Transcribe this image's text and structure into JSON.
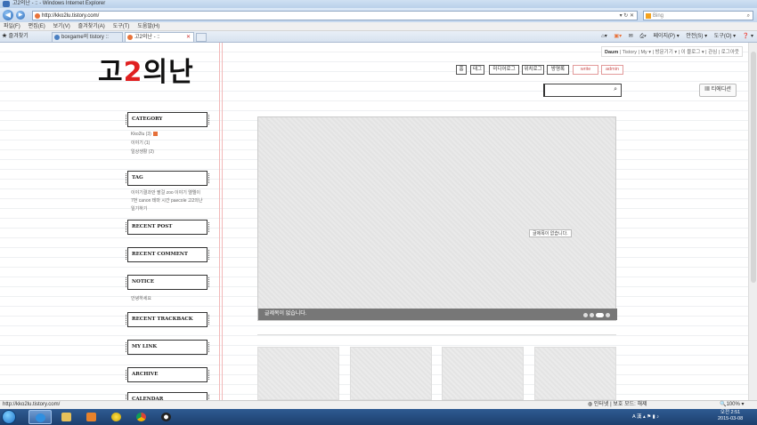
{
  "window": {
    "title": "고2의난 - :: - Windows Internet Explorer",
    "address": "http://kko2lu.tistory.com/",
    "search_placeholder": "Bing",
    "address_tools": "▾  ↻  ✕"
  },
  "menu": [
    "파일(F)",
    "편집(E)",
    "보기(V)",
    "즐겨찾기(A)",
    "도구(T)",
    "도움말(H)"
  ],
  "favorites_label": "즐겨찾기",
  "tabs": [
    {
      "label": "boxgame의 tistory ::",
      "active": false
    },
    {
      "label": "고2의난 - ::",
      "active": true
    }
  ],
  "commandbar": [
    "페이지(P) ▾",
    "안전(S) ▾",
    "도구(O) ▾",
    "❓ ▾"
  ],
  "blog": {
    "logo_part1": "고",
    "logo_red": "2",
    "logo_part2": "의난",
    "toplinks": {
      "first": "Daum",
      "rest": " | Tistory | My ▾ | 방문기기 ▾ | 이 블로그 ▾ | 관심 | 로그아웃"
    },
    "nav_pills": [
      "홈",
      "태그",
      "미디어로그",
      "위치로그",
      "방명록",
      "write",
      "admin"
    ],
    "tedition_label": "티에디션",
    "sidebar": {
      "category_title": "CATEGORY",
      "category_items": [
        "Kko2lu (3)",
        "이야기 (1)",
        "일상생활 (2)"
      ],
      "tag_title": "TAG",
      "tag_text_1": "이야기결과만 팔걸 zoo 이야기 엘엘이",
      "tag_text_2": "7번 canon 테마 시간 paecole 고2의난",
      "tag_text_3": "일기하기",
      "recent_post_title": "RECENT POST",
      "recent_comment_title": "RECENT COMMENT",
      "notice_title": "NOTICE",
      "notice_item": "안녕하세요",
      "recent_trackback_title": "RECENT TRACKBACK",
      "mylink_title": "MY LINK",
      "archive_title": "ARCHIVE",
      "calendar_title": "CALENDAR"
    },
    "slider": {
      "center_message": "글제목이 없습니다.",
      "caption": "글제목이 없습니다."
    }
  },
  "status": {
    "url": "http://kko2lu.tistory.com/",
    "zone": "인터넷 | 보호 모드: 해제",
    "zoom": "🔍100%  ▾"
  },
  "taskbar": {
    "tray_lang": "A 漢",
    "time": "오전 2:51",
    "date": "2015-03-08"
  }
}
